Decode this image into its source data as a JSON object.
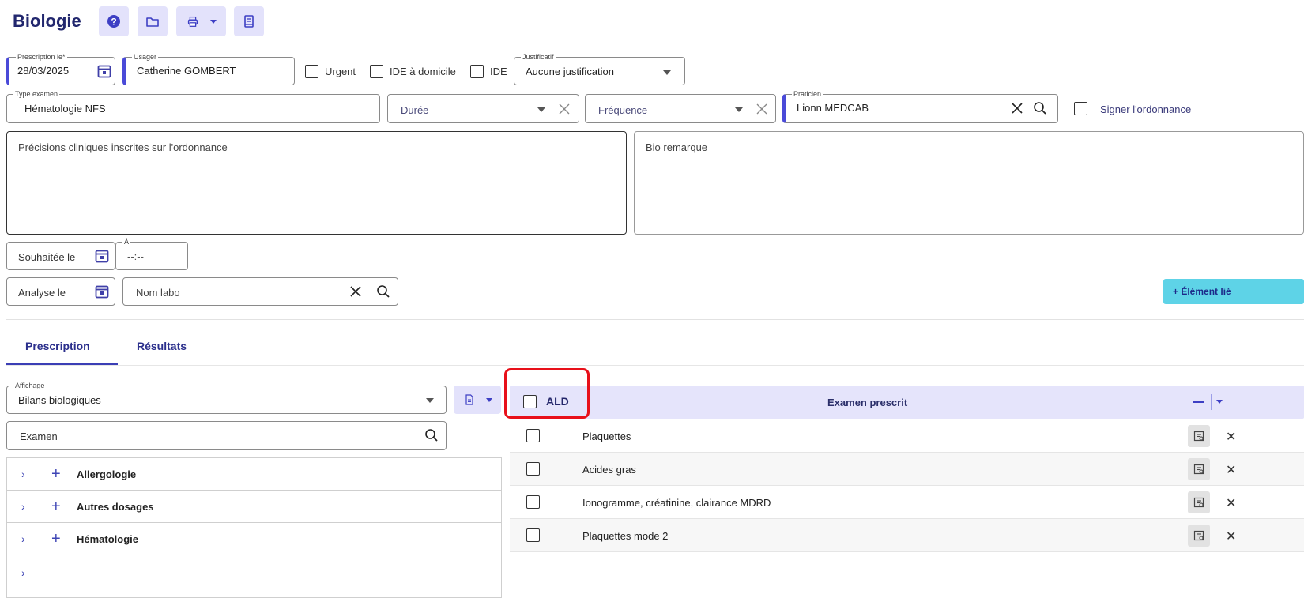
{
  "header": {
    "title": "Biologie"
  },
  "form": {
    "prescription_date": {
      "label": "Prescription le*",
      "value": "28/03/2025"
    },
    "usager": {
      "label": "Usager",
      "value": "Catherine GOMBERT"
    },
    "checkboxes": {
      "urgent": "Urgent",
      "ide_domicile": "IDE à domicile",
      "ide": "IDE"
    },
    "justificatif": {
      "label": "Justificatif",
      "value": "Aucune justification"
    },
    "type_examen": {
      "label": "Type examen",
      "value": "Hématologie NFS"
    },
    "duree": {
      "placeholder": "Durée"
    },
    "frequence": {
      "placeholder": "Fréquence"
    },
    "praticien": {
      "label": "Praticien",
      "value": "Lionn MEDCAB"
    },
    "signer_label": "Signer l'ordonnance",
    "precisions_placeholder": "Précisions cliniques inscrites sur l'ordonnance",
    "bio_remarque_placeholder": "Bio remarque",
    "souhaitee_le": "Souhaitée le",
    "a_time": {
      "label": "À",
      "value": "--:--"
    },
    "analyse_le": "Analyse le",
    "nom_labo": "Nom labo",
    "element_lie": "+ Élément lié"
  },
  "tabs": [
    {
      "label": "Prescription",
      "active": true
    },
    {
      "label": "Résultats",
      "active": false
    }
  ],
  "left_panel": {
    "affichage": {
      "label": "Affichage",
      "value": "Bilans biologiques"
    },
    "examen_placeholder": "Examen",
    "tree": [
      {
        "label": "Allergologie"
      },
      {
        "label": "Autres dosages"
      },
      {
        "label": "Hématologie"
      }
    ]
  },
  "exam_table": {
    "ald_label": "ALD",
    "header": "Examen prescrit",
    "rows": [
      {
        "label": "Plaquettes"
      },
      {
        "label": "Acides gras"
      },
      {
        "label": "Ionogramme, créatinine, clairance MDRD"
      },
      {
        "label": "Plaquettes mode 2"
      }
    ]
  },
  "colors": {
    "accent": "#4a4ad8",
    "title": "#22276e",
    "toolbar_bg": "#e3e2fb",
    "element_button": "#5ed3e7",
    "highlight": "#e8101a"
  }
}
